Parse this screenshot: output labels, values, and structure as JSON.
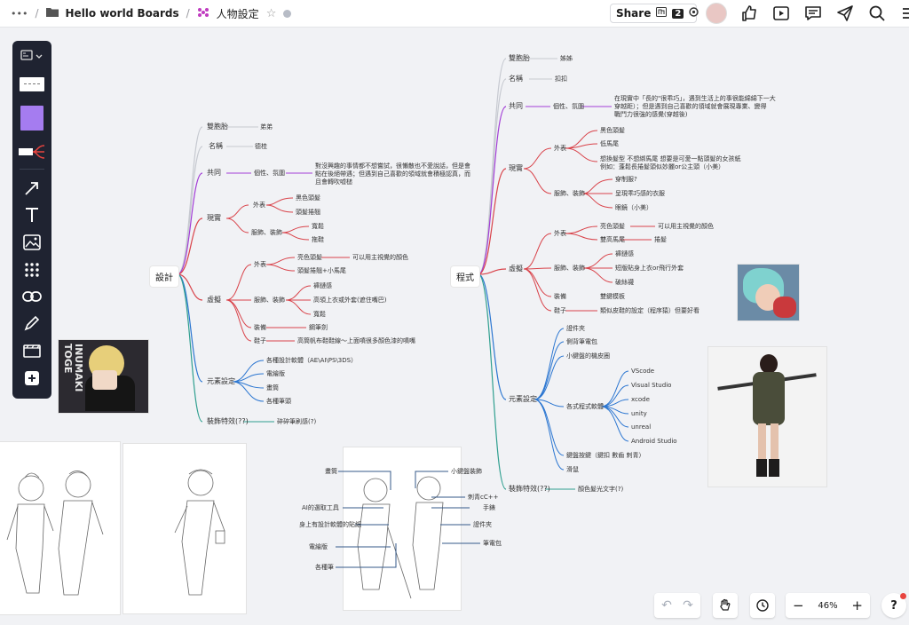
{
  "topbar": {
    "more_label": "•••",
    "board_name": "Hello world Boards",
    "page_name": "人物設定",
    "share_label": "Share",
    "share_count": "2"
  },
  "zoom": {
    "label": "46%",
    "minus": "−",
    "plus": "+",
    "help": "?"
  },
  "colors": {
    "accent_red": "#d9434a",
    "accent_purple": "#a23dd6",
    "accent_teal": "#2f9f8f",
    "accent_blue": "#2b76d1",
    "gray": "#b8bcc4",
    "toolbar": "#1f2331"
  },
  "mindmap_left": {
    "root": "設計",
    "n1": "雙胞胎",
    "n1v": "弟弟",
    "n2": "名稱",
    "n2v": "德桂",
    "n3": "共同",
    "n3a": "個性、氛圍",
    "n3v1": "對沒興趣的事情都不想嘗試，很懶散也不愛說話，但是會",
    "n3v2": "點在後絕帶遇；但遇到自己喜歡的領域就會積極認真，而",
    "n3v3": "且會轉吹嘘槌",
    "real": "現實",
    "real_a": "外表",
    "real_a1": "黑色頭髮",
    "real_a2": "頭髮捲翹",
    "real_b": "服飾、裝飾",
    "real_b1": "寬鬆",
    "real_b2": "拖鞋",
    "virt": "虛擬",
    "virt_a": "外表",
    "virt_a1": "亮色頭髮",
    "virt_a1v": "可以用主視覺的顏色",
    "virt_a2": "頭髮捲翹+小馬尾",
    "virt_b": "服飾、裝飾",
    "virt_b1": "褲鏈感",
    "virt_b2": "高領上衣或外套(遮住嘴巴)",
    "virt_b3": "寬鬆",
    "virt_c": "裝備",
    "virt_c1": "鋼筆劍",
    "virt_d": "鞋子",
    "virt_d1": "高筒帆布鞋鞋線～上面噴很多顏色漆的噴嘴",
    "elem": "元素設定",
    "elem1": "各種設計軟體（AE\\AI\\PS\\3DS）",
    "elem2": "電繪版",
    "elem3": "畫筒",
    "elem4": "各種筆頭",
    "fx": "裝飾特效(??)",
    "fx1": "碎碎筆刷感(?)"
  },
  "mindmap_right": {
    "root": "程式",
    "n1": "雙胞胎",
    "n1v": "姊姊",
    "n2": "名稱",
    "n2v": "扣扣",
    "n3": "共同",
    "n3a": "個性、氛圍",
    "n3v1": "在現實中「長的\"很乖巧」，遇到生活上的事很能綿綿下一大",
    "n3v2": "穿越距）；但是遇到自己喜歡的領域就會展現專業、變得",
    "n3v3": "戰鬥力很強的感覺(穿越後)",
    "real": "現實",
    "real_a": "外表",
    "real_a1": "黑色頭髮",
    "real_a2": "低馬尾",
    "real_a3": "想換髮型 不想綁馬尾 想要是可愛一點頭髮的女孩紙",
    "real_a4": "例如：蓬鬆長捲髮頭似妙麗or公主頭（小美）",
    "real_b": "服飾、裝飾",
    "real_b1": "穿制服?",
    "real_b2": "呈現乖巧感的衣服",
    "real_b3": "眼鏡（小美）",
    "virt": "虛擬",
    "virt_a": "外表",
    "virt_a1": "亮色頭髮",
    "virt_a1v": "可以用主視覺的顏色",
    "virt_a2": "雙高馬尾",
    "virt_a2v": "捲髮",
    "virt_b": "服飾、裝飾",
    "virt_b1": "褲鏈感",
    "virt_b2": "短版貼身上衣or飛行外套",
    "virt_b3": "破絲襪",
    "virt_c": "裝備",
    "virt_c1": "雙鍵模板",
    "virt_d": "鞋子",
    "virt_d1": "類似皮鞋的設定（程序猿）但要好看",
    "elem": "元素設定",
    "elem1": "證件夾",
    "elem2": "側背筆電包",
    "elem3": "小鍵盤的機皮圈",
    "elem4": "各式程式軟體",
    "sw1": "VScode",
    "sw2": "Visual Studio",
    "sw3": "xcode",
    "sw4": "unity",
    "sw5": "unreal",
    "sw6": "Android Studio",
    "elem5": "鍵盤按鍵（鍵扣 數齒 刺青）",
    "elem6": "滑鼠",
    "fx": "裝飾特效(??)",
    "fx1": "顏色髮光文字(?)"
  },
  "sketch_labels": {
    "l1": "畫筒",
    "l2": "AI的選取工具",
    "l3": "身上有設計軟體的貼紙",
    "l4": "電繪版",
    "l5": "各種筆",
    "r1": "小鍵盤裝飾",
    "r2": "刺青cC++",
    "r3": "手錶",
    "r4": "證件夾",
    "r5": "筆電包"
  },
  "character_card_text": "INUMAKI TOGE"
}
